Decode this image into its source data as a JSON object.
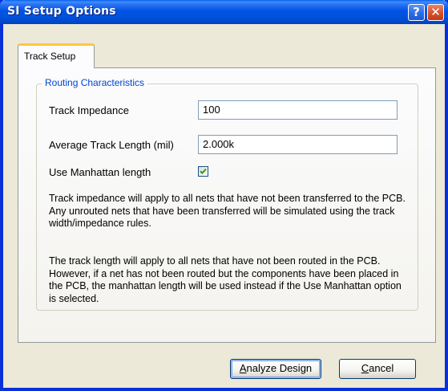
{
  "window": {
    "title": "SI Setup Options"
  },
  "titlebar_buttons": {
    "help_glyph": "?",
    "close_glyph": "✕"
  },
  "tabs": [
    {
      "label": "Track Setup",
      "active": true
    }
  ],
  "group": {
    "title": "Routing Characteristics",
    "fields": {
      "track_impedance": {
        "label": "Track Impedance",
        "value": "100"
      },
      "average_track_length": {
        "label": "Average Track Length (mil)",
        "value": "2.000k"
      },
      "use_manhattan_length": {
        "label": "Use Manhattan length",
        "checked": true
      }
    },
    "paragraphs": [
      "Track impedance will apply to all nets that have not been transferred to the PCB.  Any unrouted nets that have been transferred will be simulated using the track width/impedance rules.",
      "The track length will apply to all nets that have not been routed in the PCB.  However, if a net has not been routed but the components have been placed in the PCB, the manhattan length will be used instead if the Use Manhattan option is selected."
    ]
  },
  "buttons": {
    "analyze": {
      "mnemonic": "A",
      "rest": "nalyze Design"
    },
    "cancel": {
      "mnemonic": "C",
      "rest": "ancel"
    }
  },
  "colors": {
    "titlebar": "#0054E3",
    "group_title": "#0046D5",
    "tab_highlight": "#FFC73C",
    "checkmark": "#21A121",
    "close_button": "#D7542E"
  },
  "icons": {
    "help": "help-icon",
    "close": "close-icon",
    "checkmark": "checkmark-icon"
  }
}
